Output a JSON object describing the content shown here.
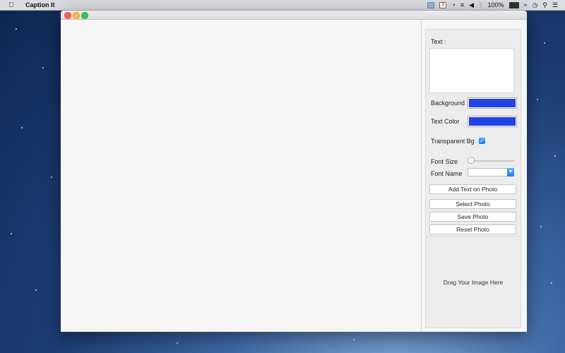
{
  "menubar": {
    "app_name": "Caption It",
    "battery_percent": "100%"
  },
  "icons": {
    "apple": "apple-logo-icon",
    "calendar": "calendar-icon",
    "speaker": "speaker-icon",
    "bluetooth": "bluetooth-icon",
    "wifi": "wifi-icon",
    "clock": "clock-icon",
    "search": "search-icon",
    "list": "list-icon"
  },
  "calendar_day": "5",
  "panel": {
    "text_label": "Text :",
    "text_value": "",
    "background_label": "Background",
    "background_color": "#2042e6",
    "text_color_label": "Text Color",
    "text_color": "#2042e6",
    "transparent_label": "Transparent Bg",
    "transparent_checked": true,
    "font_size_label": "Font Size",
    "font_size_level": 0,
    "font_name_label": "Font Name",
    "font_name_value": "",
    "buttons": {
      "add_text": "Add Text on Photo",
      "select_photo": "Select Photo",
      "save_photo": "Save Photo",
      "reset_photo": "Reset Photo"
    },
    "drop_label": "Drag Your Image Here"
  }
}
